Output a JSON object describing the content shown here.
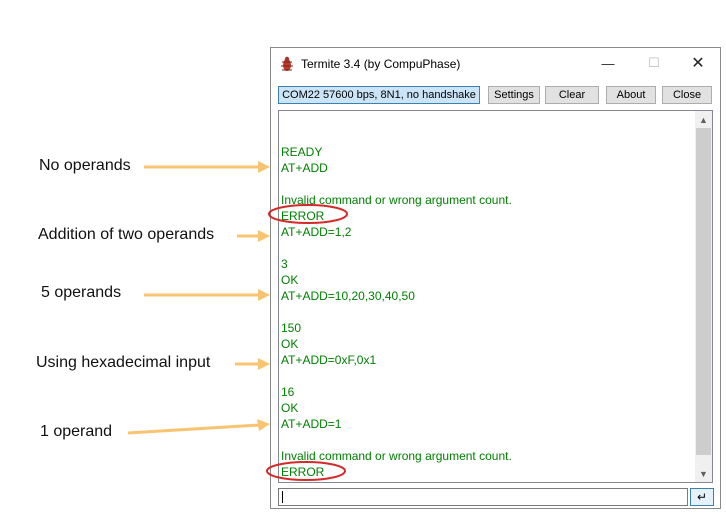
{
  "annotations": [
    {
      "label": "No operands"
    },
    {
      "label": "Addition of two operands"
    },
    {
      "label": "5 operands"
    },
    {
      "label": "Using hexadecimal input"
    },
    {
      "label": "1 operand"
    }
  ],
  "window": {
    "title": "Termite 3.4 (by CompuPhase)",
    "app_icon": "termite-icon",
    "controls": {
      "minimize": "—",
      "maximize": "☐",
      "close": "✕"
    }
  },
  "toolbar": {
    "port_label": "COM22 57600 bps, 8N1, no handshake",
    "settings_label": "Settings",
    "clear_label": "Clear",
    "about_label": "About",
    "close_label": "Close"
  },
  "terminal": {
    "text_color": "#008000",
    "lines": [
      "READY",
      "AT+ADD",
      "",
      "Invalid command or wrong argument count.",
      "ERROR",
      "AT+ADD=1,2",
      "",
      "3",
      "OK",
      "AT+ADD=10,20,30,40,50",
      "",
      "150",
      "OK",
      "AT+ADD=0xF,0x1",
      "",
      "16",
      "OK",
      "AT+ADD=1",
      "",
      "Invalid command or wrong argument count.",
      "ERROR"
    ]
  },
  "input": {
    "value": ""
  },
  "colors": {
    "arrow": "#f8c471",
    "highlight_ellipse": "#d42a2a",
    "port_button_bg": "#cce4f7"
  }
}
